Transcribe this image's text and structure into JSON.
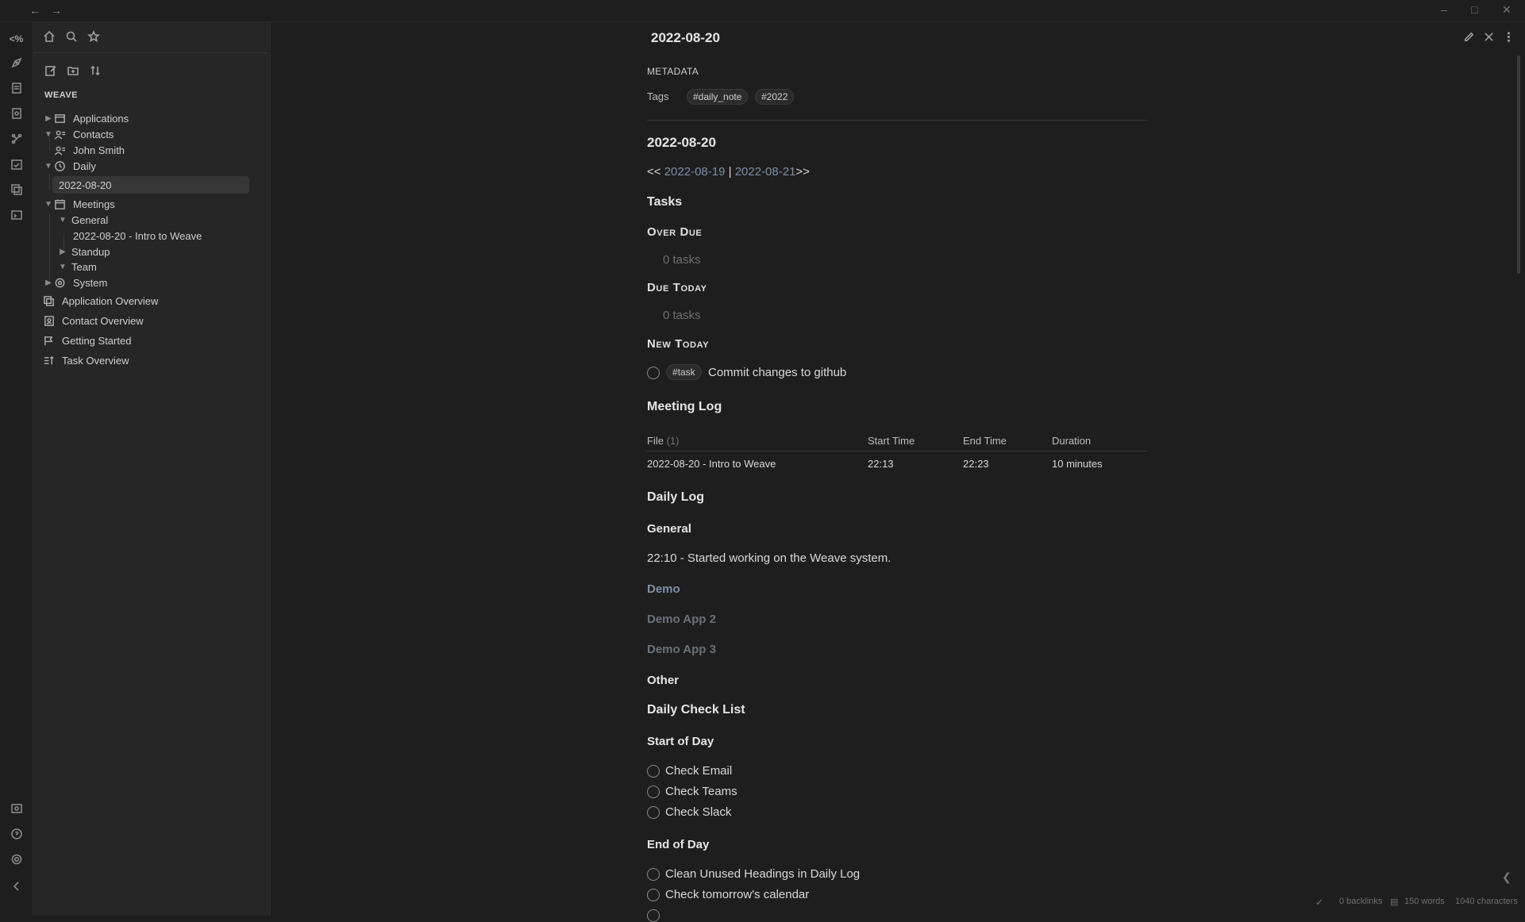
{
  "titlebar": {
    "back": "←",
    "forward": "→",
    "min": "–",
    "max": "□",
    "close": "✕"
  },
  "ribbon": {
    "logo": "<%"
  },
  "sidebar": {
    "vault_name": "WEAVE",
    "tree": [
      {
        "label": "Applications"
      },
      {
        "label": "Contacts"
      },
      {
        "label": "John Smith"
      },
      {
        "label": "Daily"
      },
      {
        "label": "2022-08-20"
      },
      {
        "label": "Meetings"
      },
      {
        "label": "General"
      },
      {
        "label": "2022-08-20 - Intro to Weave"
      },
      {
        "label": "Standup"
      },
      {
        "label": "Team"
      },
      {
        "label": "System"
      },
      {
        "label": "Application Overview"
      },
      {
        "label": "Contact Overview"
      },
      {
        "label": "Getting Started"
      },
      {
        "label": "Task Overview"
      }
    ]
  },
  "note": {
    "title": "2022-08-20",
    "metadata_label": "METADATA",
    "tags_label": "Tags",
    "tags": [
      "#daily_note",
      "#2022"
    ],
    "heading": "2022-08-20",
    "nav": {
      "prev_prefix": "<<",
      "prev": "2022-08-19",
      "sep": "|",
      "next": "2022-08-21",
      "next_suffix": ">>"
    },
    "tasks": {
      "heading": "Tasks",
      "overdue": "Over Due",
      "overdue_count": "0 tasks",
      "due_today": "Due Today",
      "due_today_count": "0 tasks",
      "new_today": "New Today",
      "task_tag": "#task",
      "task_text": "Commit changes to github"
    },
    "meeting_log": {
      "heading": "Meeting Log",
      "columns": {
        "file": "File",
        "file_count": "(1)",
        "start": "Start Time",
        "end": "End Time",
        "duration": "Duration"
      },
      "rows": [
        {
          "file": "2022-08-20 - Intro to Weave",
          "start": "22:13",
          "end": "22:23",
          "duration": "10 minutes"
        }
      ]
    },
    "daily_log": {
      "heading": "Daily Log",
      "general": "General",
      "entry": "22:10 - Started working on the Weave system.",
      "demo": "Demo",
      "demo2": "Demo App 2",
      "demo3": "Demo App 3",
      "other": "Other"
    },
    "checklist": {
      "heading": "Daily Check List",
      "start_heading": "Start of Day",
      "start_items": [
        "Check Email",
        "Check Teams",
        "Check Slack"
      ],
      "end_heading": "End of Day",
      "end_items": [
        "Clean Unused Headings in Daily Log",
        "Check tomorrow's calendar"
      ]
    }
  },
  "status": {
    "backlinks": "0 backlinks",
    "words": "150 words",
    "characters": "1040 characters"
  }
}
